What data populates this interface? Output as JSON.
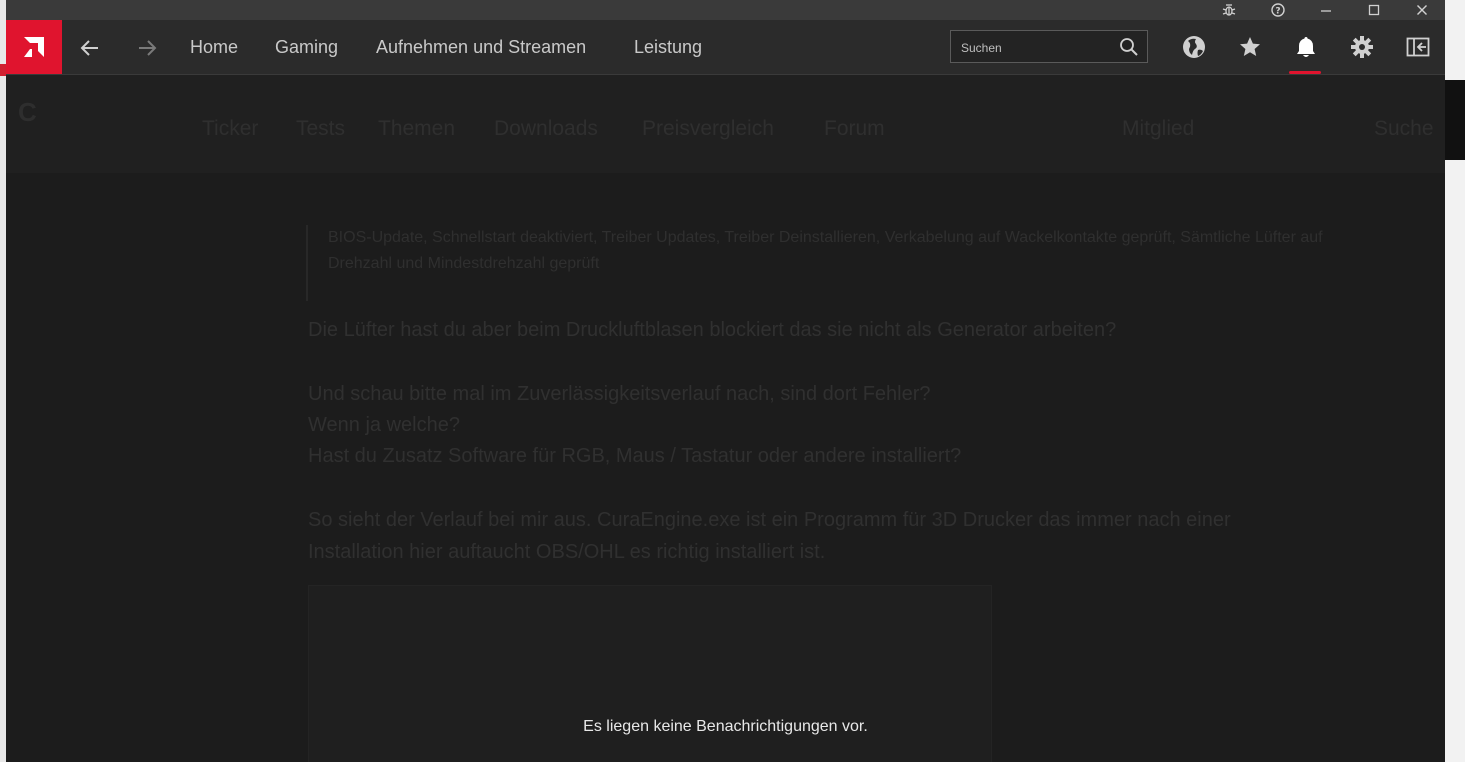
{
  "app": {
    "nav": {
      "back_icon": "arrow-left-icon",
      "forward_icon": "arrow-right-icon",
      "tabs": [
        {
          "label": "Home"
        },
        {
          "label": "Gaming"
        },
        {
          "label": "Aufnehmen und Streamen"
        },
        {
          "label": "Leistung"
        }
      ]
    },
    "search": {
      "placeholder": "Suchen"
    },
    "icons": [
      "globe-icon",
      "star-icon",
      "bell-icon",
      "gear-icon",
      "sidebar-toggle-icon"
    ],
    "titlebar_icons": [
      "bug-icon",
      "help-icon",
      "minimize-icon",
      "maximize-icon",
      "close-icon"
    ],
    "accent_color": "#e0142e"
  },
  "notifications": {
    "empty_message": "Es liegen keine Benachrichtigungen vor."
  },
  "background_page": {
    "nav_items": [
      "Ticker",
      "Tests",
      "Themen",
      "Downloads",
      "Preisvergleich",
      "Forum"
    ],
    "right_items": [
      "Mitglied",
      "Suche"
    ],
    "quote": "BIOS-Update, Schnellstart deaktiviert, Treiber Updates, Treiber Deinstallieren, Verkabelung auf Wackelkontakte geprüft, Sämtliche Lüfter auf Drehzahl und Mindestdrehzahl geprüft",
    "post_lines": [
      "Die Lüfter hast du aber beim Druckluftblasen blockiert das sie nicht als Generator arbeiten?",
      "Und schau bitte mal im Zuverlässigkeitsverlauf nach, sind dort Fehler?",
      "Wenn ja welche?",
      "Hast du Zusatz Software für RGB, Maus / Tastatur oder andere installiert?",
      "So sieht der Verlauf bei mir aus. CuraEngine.exe ist ein Programm für 3D Drucker das immer nach einer",
      "Installation hier auftaucht OBS/OHL es richtig installiert ist."
    ]
  }
}
